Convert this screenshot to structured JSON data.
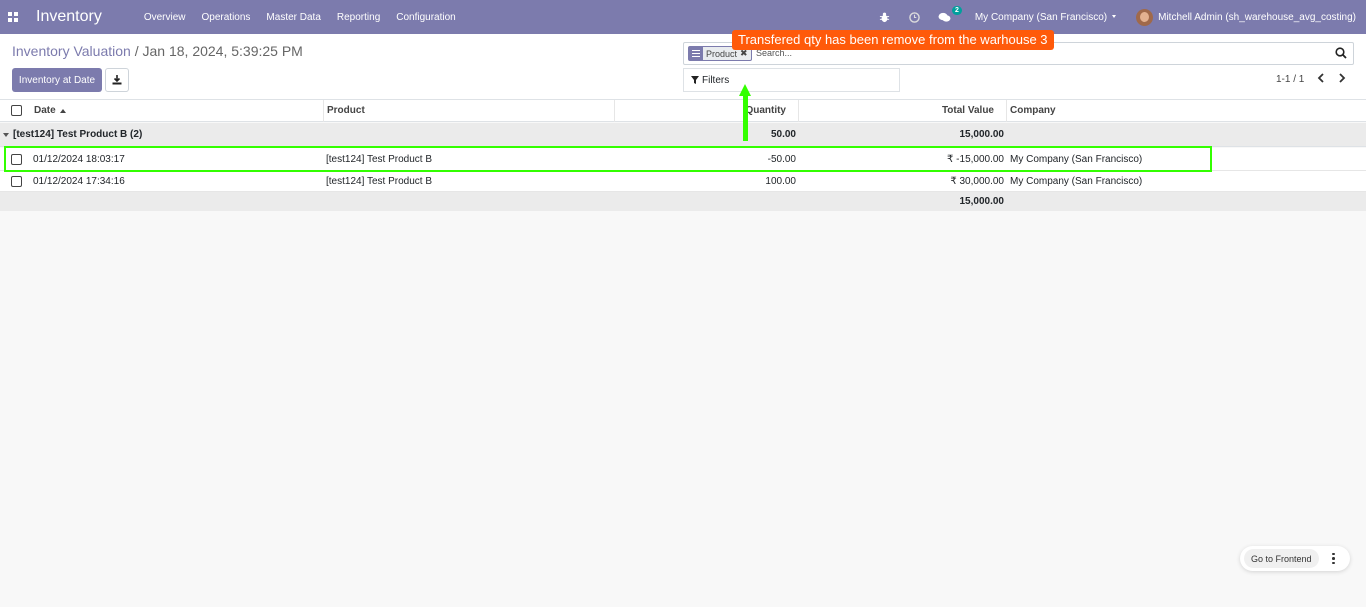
{
  "navbar": {
    "app_title": "Inventory",
    "menu": [
      "Overview",
      "Operations",
      "Master Data",
      "Reporting",
      "Configuration"
    ],
    "messages_badge": "2",
    "company": "My Company (San Francisco)",
    "user": "Mitchell Admin (sh_warehouse_avg_costing)",
    "color": "#7c7bad"
  },
  "control": {
    "breadcrumb_parent": "Inventory Valuation",
    "breadcrumb_sep": "/",
    "breadcrumb_current": "Jan 18, 2024, 5:39:25 PM",
    "inventory_at_date_label": "Inventory at Date",
    "search": {
      "facet_label": "Product",
      "facet_remove": "✖",
      "placeholder": "Search..."
    },
    "filters_label": "Filters",
    "pager": "1-1 / 1"
  },
  "annotation": {
    "tooltip": "Transfered qty has been remove from the warhouse 3",
    "tooltip_color": "#ff5a0a",
    "highlight_color": "#33ff00"
  },
  "table": {
    "headers": {
      "date": "Date",
      "product": "Product",
      "quantity": "Quantity",
      "total_value": "Total Value",
      "company": "Company"
    },
    "group": {
      "label": "[test124] Test Product B (2)",
      "quantity": "50.00",
      "total_value": "15,000.00"
    },
    "rows": [
      {
        "date": "01/12/2024 18:03:17",
        "product": "[test124] Test Product B",
        "quantity": "-50.00",
        "total_value": "₹ -15,000.00",
        "company": "My Company (San Francisco)"
      },
      {
        "date": "01/12/2024 17:34:16",
        "product": "[test124] Test Product B",
        "quantity": "100.00",
        "total_value": "₹ 30,000.00",
        "company": "My Company (San Francisco)"
      }
    ],
    "footer_total": "15,000.00"
  },
  "frontend": {
    "go_to_frontend": "Go to Frontend"
  }
}
